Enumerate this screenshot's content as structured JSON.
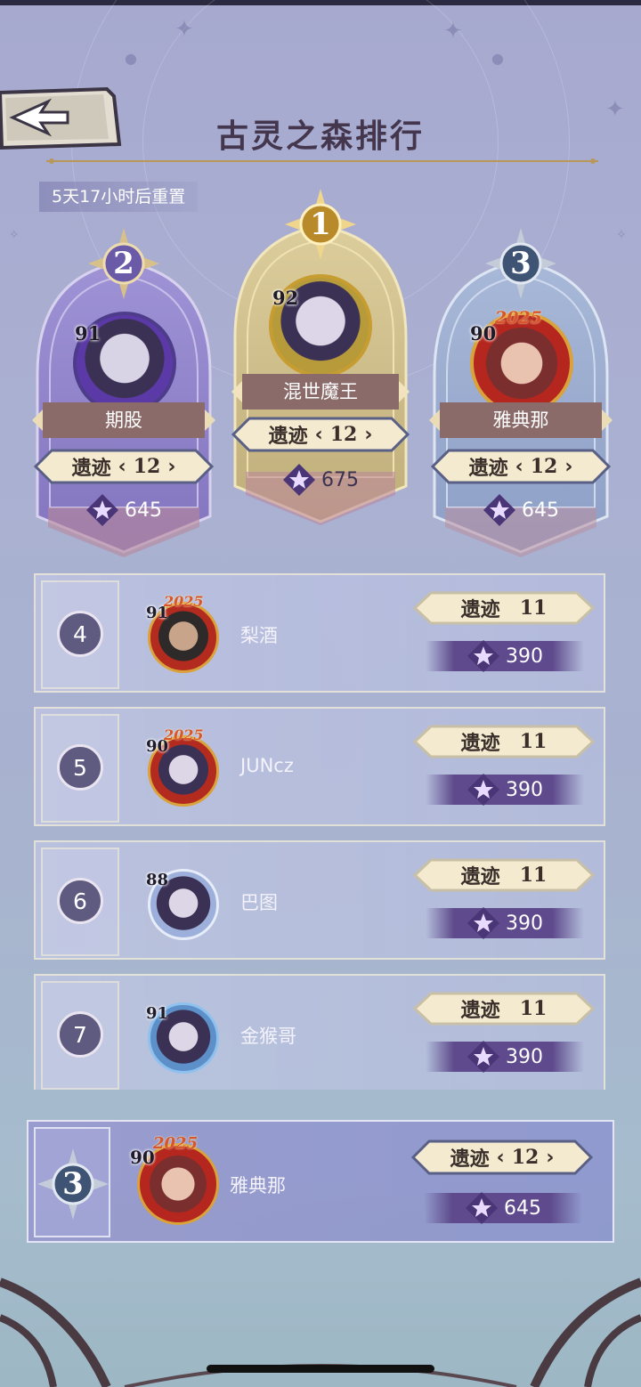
{
  "header": {
    "title": "古灵之森排行",
    "reset_text": "5天17小时后重置"
  },
  "podium": [
    {
      "rank": "1",
      "level": "92",
      "name": "混世魔王",
      "relic_label": "遗迹",
      "relic_value": "12",
      "score": "675",
      "theme": "gold"
    },
    {
      "rank": "2",
      "level": "91",
      "name": "期股",
      "relic_label": "遗迹",
      "relic_value": "12",
      "score": "645",
      "theme": "purple"
    },
    {
      "rank": "3",
      "level": "90",
      "name": "雅典那",
      "relic_label": "遗迹",
      "relic_value": "12",
      "score": "645",
      "theme": "blue",
      "badge": "2025"
    }
  ],
  "rows": [
    {
      "rank": "4",
      "level": "91",
      "badge": "2025",
      "name": "梨酒",
      "relic_label": "遗迹",
      "relic_value": "11",
      "score": "390"
    },
    {
      "rank": "5",
      "level": "90",
      "badge": "2025",
      "name": "JUNcz",
      "relic_label": "遗迹",
      "relic_value": "11",
      "score": "390"
    },
    {
      "rank": "6",
      "level": "88",
      "badge": "",
      "name": "巴图",
      "relic_label": "遗迹",
      "relic_value": "11",
      "score": "390"
    },
    {
      "rank": "7",
      "level": "91",
      "badge": "",
      "name": "金猴哥",
      "relic_label": "遗迹",
      "relic_value": "11",
      "score": "390"
    }
  ],
  "my_rank": {
    "rank": "3",
    "level": "90",
    "badge": "2025",
    "name": "雅典那",
    "relic_label": "遗迹",
    "relic_value": "12",
    "score": "645"
  },
  "colors": {
    "gold": "#c9b37a",
    "purple": "#8c7fc8",
    "blue": "#8ea3c9",
    "score_bar": "#5e4a8c"
  }
}
